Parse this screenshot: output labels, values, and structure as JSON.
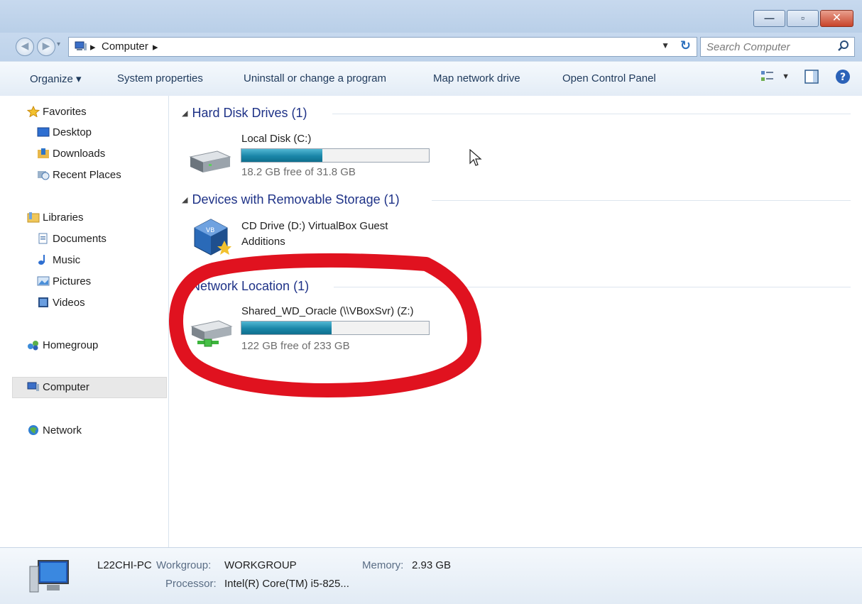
{
  "window": {
    "buttons": {
      "minimize": "—",
      "maximize": "▫",
      "close": "✕"
    }
  },
  "address": {
    "breadcrumb": [
      "Computer"
    ],
    "search_placeholder": "Search Computer"
  },
  "toolbar": {
    "organize": "Organize ▾",
    "system_properties": "System properties",
    "uninstall": "Uninstall or change a program",
    "map_drive": "Map network drive",
    "control_panel": "Open Control Panel"
  },
  "sidebar": {
    "favorites": "Favorites",
    "desktop": "Desktop",
    "downloads": "Downloads",
    "recent": "Recent Places",
    "libraries": "Libraries",
    "documents": "Documents",
    "music": "Music",
    "pictures": "Pictures",
    "videos": "Videos",
    "homegroup": "Homegroup",
    "computer": "Computer",
    "network": "Network"
  },
  "groups": {
    "hdd": {
      "title": "Hard Disk Drives (1)",
      "drive": {
        "name": "Local Disk (C:)",
        "free": "18.2 GB free of 31.8 GB",
        "used_fraction": 0.43
      }
    },
    "removable": {
      "title": "Devices with Removable Storage (1)",
      "drive": {
        "name_line1": "CD Drive (D:) VirtualBox Guest",
        "name_line2": "Additions"
      }
    },
    "network": {
      "title": "Network Location (1)",
      "drive": {
        "name": "Shared_WD_Oracle (\\\\VBoxSvr) (Z:)",
        "free": "122 GB free of 233 GB",
        "used_fraction": 0.48
      }
    }
  },
  "details": {
    "pc_name": "L22CHI-PC",
    "workgroup_label": "Workgroup:",
    "workgroup": "WORKGROUP",
    "memory_label": "Memory:",
    "memory": "2.93 GB",
    "processor_label": "Processor:",
    "processor": "Intel(R) Core(TM) i5-825..."
  },
  "colors": {
    "annotation": "#e0121f",
    "bar_fill": "#1a86a8",
    "group_header": "#1e3287"
  }
}
